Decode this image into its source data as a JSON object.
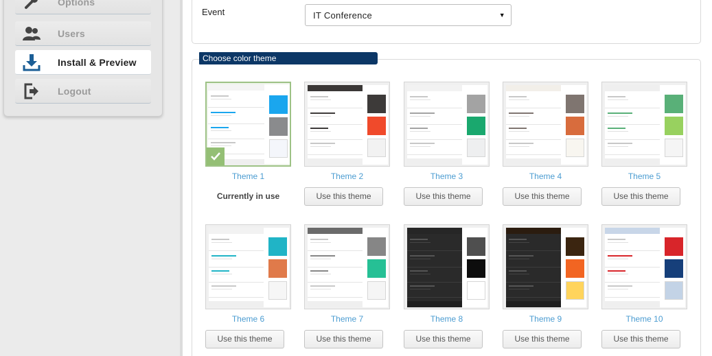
{
  "sidebar": {
    "items": [
      {
        "label": "Options",
        "icon": "wrench-icon",
        "active": false
      },
      {
        "label": "Users",
        "icon": "users-icon",
        "active": false
      },
      {
        "label": "Install & Preview",
        "icon": "download-icon",
        "active": true
      },
      {
        "label": "Logout",
        "icon": "logout-icon",
        "active": false
      }
    ]
  },
  "event": {
    "label": "Event",
    "selected": "IT Conference"
  },
  "themes_section": {
    "heading": "Choose color theme",
    "current_label": "Currently in use",
    "use_label": "Use this theme",
    "themes": [
      {
        "name": "Theme 1",
        "selected": true,
        "header": "#f4f4f4",
        "dark": false,
        "swatches": [
          "#1aa6ee",
          "#8a8b8d",
          "#f4f6fb"
        ]
      },
      {
        "name": "Theme 2",
        "selected": false,
        "header": "#3a3736",
        "dark": false,
        "swatches": [
          "#3d3a39",
          "#f04a2b",
          "#f2f2f2"
        ]
      },
      {
        "name": "Theme 3",
        "selected": false,
        "header": "#f2f2f2",
        "dark": false,
        "swatches": [
          "#a3a3a3",
          "#1aa86e",
          "#eeeff0"
        ]
      },
      {
        "name": "Theme 4",
        "selected": false,
        "header": "#f2efe9",
        "dark": false,
        "swatches": [
          "#7f7570",
          "#d86c3d",
          "#f8f6f0"
        ]
      },
      {
        "name": "Theme 5",
        "selected": false,
        "header": "#efefef",
        "dark": false,
        "swatches": [
          "#59b078",
          "#98d15f",
          "#f5f5f5"
        ]
      },
      {
        "name": "Theme 6",
        "selected": false,
        "header": "#f2f2f2",
        "dark": false,
        "swatches": [
          "#20b4c6",
          "#e07a4a",
          "#f6f6f6"
        ]
      },
      {
        "name": "Theme 7",
        "selected": false,
        "header": "#6b6b6b",
        "dark": false,
        "swatches": [
          "#868686",
          "#26c095",
          "#f5f5f5"
        ]
      },
      {
        "name": "Theme 8",
        "selected": false,
        "header": "#262626",
        "dark": true,
        "swatches": [
          "#4f4f4f",
          "#0d0d0d",
          "#ffffff"
        ]
      },
      {
        "name": "Theme 9",
        "selected": false,
        "header": "#2b1c0f",
        "dark": true,
        "swatches": [
          "#3b2510",
          "#f26522",
          "#ffd45c"
        ]
      },
      {
        "name": "Theme 10",
        "selected": false,
        "header": "#c8d6e8",
        "dark": false,
        "swatches": [
          "#d8252a",
          "#163f7a",
          "#c3d3e6"
        ]
      }
    ]
  }
}
